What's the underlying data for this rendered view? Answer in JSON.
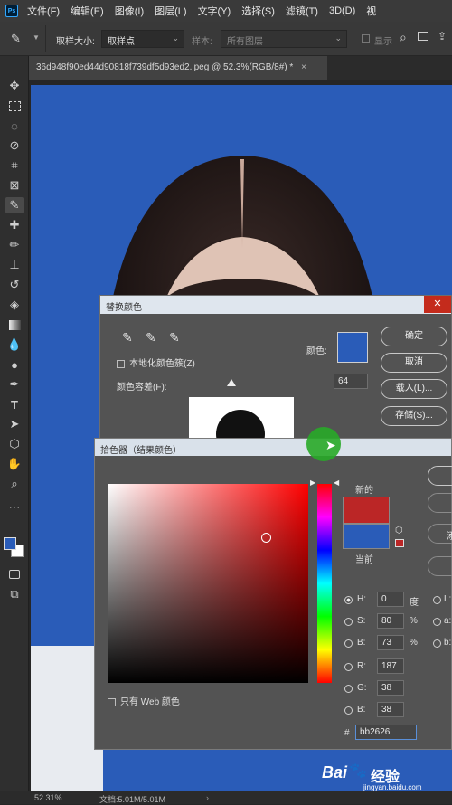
{
  "menubar": {
    "logo": "Ps",
    "items": [
      "文件(F)",
      "编辑(E)",
      "图像(I)",
      "图层(L)",
      "文字(Y)",
      "选择(S)",
      "滤镜(T)",
      "3D(D)",
      "视"
    ]
  },
  "options": {
    "sample_size_label": "取样大小:",
    "sample_size_value": "取样点",
    "sample_label": "样本:",
    "sample_value": "所有图层",
    "show_label": "显示"
  },
  "tab": {
    "title": "36d948f90ed44d90818f739df5d93ed2.jpeg @ 52.3%(RGB/8#) *",
    "close": "×"
  },
  "status": {
    "zoom": "52.31%",
    "doc": "文档:5.01M/5.01M"
  },
  "replace_color": {
    "title": "替换颜色",
    "localized_label": "本地化颜色簇(Z)",
    "color_label": "颜色:",
    "fuzziness_label": "颜色容差(F):",
    "fuzziness_value": "64",
    "fuzziness_fraction": 0.32,
    "swatch_color": "#2a5cb8",
    "ok": "确定",
    "cancel": "取消",
    "load": "载入(L)...",
    "save": "存储(S)..."
  },
  "color_picker": {
    "title": "拾色器（结果颜色）",
    "new_label": "新的",
    "current_label": "当前",
    "new_color": "#bb2626",
    "current_color": "#2a5cb8",
    "web_only_label": "只有 Web 颜色",
    "h_label": "H:",
    "h_value": "0",
    "h_unit": "度",
    "s_label": "S:",
    "s_value": "80",
    "s_unit": "%",
    "b_label": "B:",
    "b_value": "73",
    "b_unit": "%",
    "r_label": "R:",
    "r_value": "187",
    "g_label": "G:",
    "g_value": "38",
    "bl_label": "B:",
    "bl_value": "38",
    "hex_label": "#",
    "hex_value": "bb2626",
    "lab_l": "L:",
    "lab_a": "a:",
    "lab_b": "b:",
    "side_btn": "添"
  },
  "watermark": {
    "brand": "Bai",
    "brand2": "经验",
    "url": "jingyan.baidu.com"
  }
}
